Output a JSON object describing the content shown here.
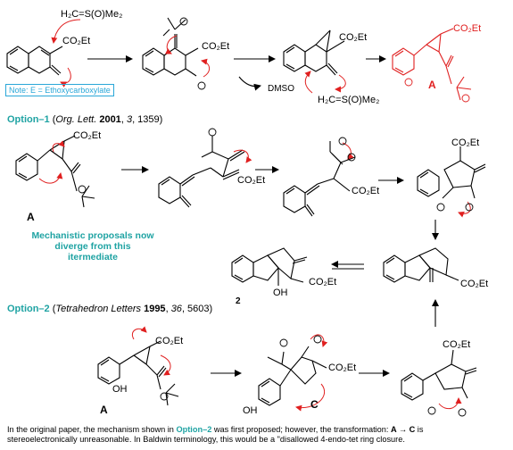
{
  "reagent_top": "H₂C=S(O)Me₂",
  "reagent_mid": "H₂C=S(O)Me₂",
  "ester": "CO₂Et",
  "ester_b": "CO₂Et",
  "ester_c": "CO₂Et",
  "ester_d": "CO₂Et",
  "ester_e": "CO₂Et",
  "ester_f": "CO₂Et",
  "ester_g": "CO₂Et",
  "ester_h": "CO₂Et",
  "ester_i": "CO₂Et",
  "ester_j": "CO₂Et",
  "ester_k": "CO₂Et",
  "ester_l": "CO₂Et",
  "ester_m": "CO₂Et",
  "ester_n": "CO₂Et",
  "dmso": "DMSO",
  "note": "Note:  E = Ethoxycarboxylate",
  "option1_title": "Option–1",
  "option1_ref_journal": "Org. Lett.",
  "option1_ref_year": "2001",
  "option1_ref_vol": "3",
  "option1_ref_page": ", 1359)",
  "option2_title": "Option–2",
  "option2_ref_journal": "Tetrahedron Letters",
  "option2_ref_year": "1995",
  "option2_ref_vol": "36",
  "option2_ref_page": ", 5603)",
  "diverge_line1": "Mechanistic proposals now",
  "diverge_line2": "diverge from this",
  "diverge_line3": "itermediate",
  "label_A1": "A",
  "label_A2": "A",
  "label_A3": "A",
  "label_C": "C",
  "label_2": "2",
  "oh_a": "OH",
  "oh_b": "OH",
  "oh_c": "OH",
  "caption_line1_pre": "In the original  paper, the mechanism shown in ",
  "caption_line1_hl": "Option–2",
  "caption_line1_post": " was first proposed; however, the transformation: ",
  "caption_line1_AC": "A → C",
  "caption_line1_end": " is",
  "caption_line2": "stereoelectronically unreasonable. In Baldwin terminology, this would be a \"disallowed 4-endo-tet ring closure."
}
